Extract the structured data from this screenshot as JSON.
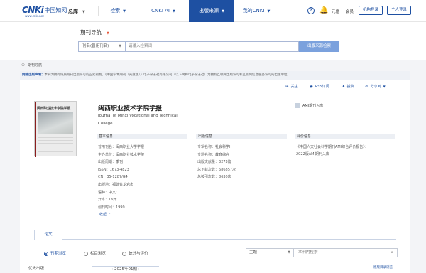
{
  "nav": {
    "logo_mark": "CNKi",
    "logo_cn": "中国知网",
    "logo_url": "www.cnki.net",
    "home": "总库",
    "search": "检索",
    "ai": "CNKI AI",
    "source": "出版来源",
    "mycnki": "我的CNKI",
    "help_icon_label": "?",
    "bell": "🔔",
    "cici": "元億",
    "member": "会员",
    "institution_login": "机构登录",
    "personal_login": "个人登录"
  },
  "search": {
    "title": "期刊导航",
    "select_value": "刊名(曾用刊名)",
    "input_placeholder": "请输入检索词",
    "button": "出版来源检索"
  },
  "breadcrumb": "期刊导航",
  "notice": {
    "label": "网络出版声明：",
    "text": "本刊为拥有纸质期刊出版许可的正式刊物，《中国学术期刊（光盘版）》电子杂志社有限公司（以下简称电子杂志社）为拥有互联网出版许可和互联网信息服务许可的出版单位……"
  },
  "actions": {
    "follow": "关注",
    "rss": "RSS订阅",
    "submit": "投稿",
    "share": "分享到"
  },
  "journal": {
    "cover_title": "闽西职业技术学院学报",
    "title": "闽西职业技术学院学报",
    "en_title": "Journal of Minxi Vocational and Technical College",
    "db_badge": "AMI期刊入库"
  },
  "basic": {
    "header": "基本信息",
    "items": [
      {
        "k": "曾用刊名：",
        "v": "闽西职业大学学报"
      },
      {
        "k": "主办单位：",
        "v": "闽西职业技术学院"
      },
      {
        "k": "出版周期：",
        "v": "季刊"
      },
      {
        "k": "ISSN：",
        "v": "1673-4823"
      },
      {
        "k": "CN：",
        "v": "35-1287/G4"
      },
      {
        "k": "出版地：",
        "v": "福建省龙岩市"
      },
      {
        "k": "语种：",
        "v": "中文;"
      },
      {
        "k": "开本：",
        "v": "16开"
      },
      {
        "k": "创刊时间：",
        "v": "1999"
      }
    ],
    "more": "收起"
  },
  "publish": {
    "header": "出版信息",
    "items": [
      {
        "k": "专辑名称：",
        "v": "社会科学II"
      },
      {
        "k": "专题名称：",
        "v": "教育综合"
      },
      {
        "k": "出版文献量：",
        "v": "3273篇"
      },
      {
        "k": "总下载次数：",
        "v": "686857次"
      },
      {
        "k": "总被引次数：",
        "v": "8630次"
      }
    ]
  },
  "eval": {
    "header": "评价信息",
    "items": [
      "《中国人文社会科学期刊AMI综合评价报告》：",
      "2022版AMI期刊入库"
    ]
  },
  "tabs": {
    "active": "论文"
  },
  "browse": {
    "opt1": "刊期浏览",
    "opt2": "栏目浏览",
    "opt3": "统计与评价",
    "subject": "主题",
    "in_search_placeholder": "本刊内检索"
  },
  "bottom": {
    "first_publish": "优先出版",
    "year": "2025年01期",
    "catalog_link": "原版目录浏览"
  }
}
